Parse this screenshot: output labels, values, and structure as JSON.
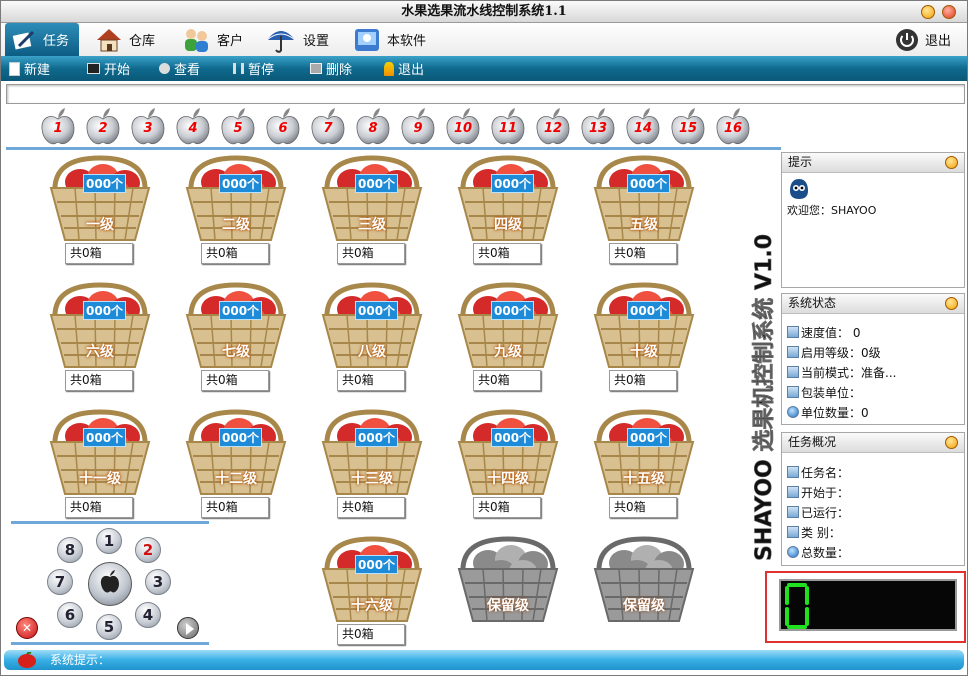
{
  "window": {
    "title": "水果选果流水线控制系统1.1"
  },
  "menu": {
    "items": [
      {
        "label": "任务",
        "icon": "pen-paper-icon"
      },
      {
        "label": "仓库",
        "icon": "house-icon"
      },
      {
        "label": "客户",
        "icon": "users-icon"
      },
      {
        "label": "设置",
        "icon": "umbrella-icon"
      },
      {
        "label": "本软件",
        "icon": "mac-icon"
      }
    ],
    "exit_label": "退出"
  },
  "toolbar": {
    "items": [
      {
        "label": "新建",
        "icon": "new-doc-icon"
      },
      {
        "label": "开始",
        "icon": "monitor-icon"
      },
      {
        "label": "查看",
        "icon": "view-icon"
      },
      {
        "label": "暂停",
        "icon": "pause-icon"
      },
      {
        "label": "删除",
        "icon": "delete-icon"
      },
      {
        "label": "退出",
        "icon": "runner-icon"
      }
    ]
  },
  "apples": [
    "1",
    "2",
    "3",
    "4",
    "5",
    "6",
    "7",
    "8",
    "9",
    "10",
    "11",
    "12",
    "13",
    "14",
    "15",
    "16"
  ],
  "baskets": [
    {
      "count": "000个",
      "level": "一级",
      "boxes": "共0箱"
    },
    {
      "count": "000个",
      "level": "二级",
      "boxes": "共0箱"
    },
    {
      "count": "000个",
      "level": "三级",
      "boxes": "共0箱"
    },
    {
      "count": "000个",
      "level": "四级",
      "boxes": "共0箱"
    },
    {
      "count": "000个",
      "level": "五级",
      "boxes": "共0箱"
    },
    {
      "count": "000个",
      "level": "六级",
      "boxes": "共0箱"
    },
    {
      "count": "000个",
      "level": "七级",
      "boxes": "共0箱"
    },
    {
      "count": "000个",
      "level": "八级",
      "boxes": "共0箱"
    },
    {
      "count": "000个",
      "level": "九级",
      "boxes": "共0箱"
    },
    {
      "count": "000个",
      "level": "十级",
      "boxes": "共0箱"
    },
    {
      "count": "000个",
      "level": "十一级",
      "boxes": "共0箱"
    },
    {
      "count": "000个",
      "level": "十二级",
      "boxes": "共0箱"
    },
    {
      "count": "000个",
      "level": "十三级",
      "boxes": "共0箱"
    },
    {
      "count": "000个",
      "level": "十四级",
      "boxes": "共0箱"
    },
    {
      "count": "000个",
      "level": "十五级",
      "boxes": "共0箱"
    },
    {
      "count": "000个",
      "level": "十六级",
      "boxes": "共0箱"
    }
  ],
  "reserved": [
    {
      "level": "保留级"
    },
    {
      "level": "保留级"
    }
  ],
  "keypad": {
    "keys": [
      "1",
      "2",
      "3",
      "4",
      "5",
      "6",
      "7",
      "8"
    ]
  },
  "side_text": "SHAYOO 选果机控制系统 V1.0",
  "tips": {
    "title": "提示",
    "welcome": "欢迎您：SHAYOO"
  },
  "system_status": {
    "title": "系统状态",
    "rows": [
      "速度值：  0",
      "启用等级：0级",
      "当前模式：准备...",
      "包装单位：",
      "单位数量：0"
    ]
  },
  "task_overview": {
    "title": "任务概况",
    "rows": [
      "任务名：",
      "开始于：",
      "已运行：",
      "类   别：",
      "总数量："
    ]
  },
  "digit_display": {
    "value": "0",
    "color": "#20e020"
  },
  "status_bar": {
    "label": "系统提示："
  }
}
